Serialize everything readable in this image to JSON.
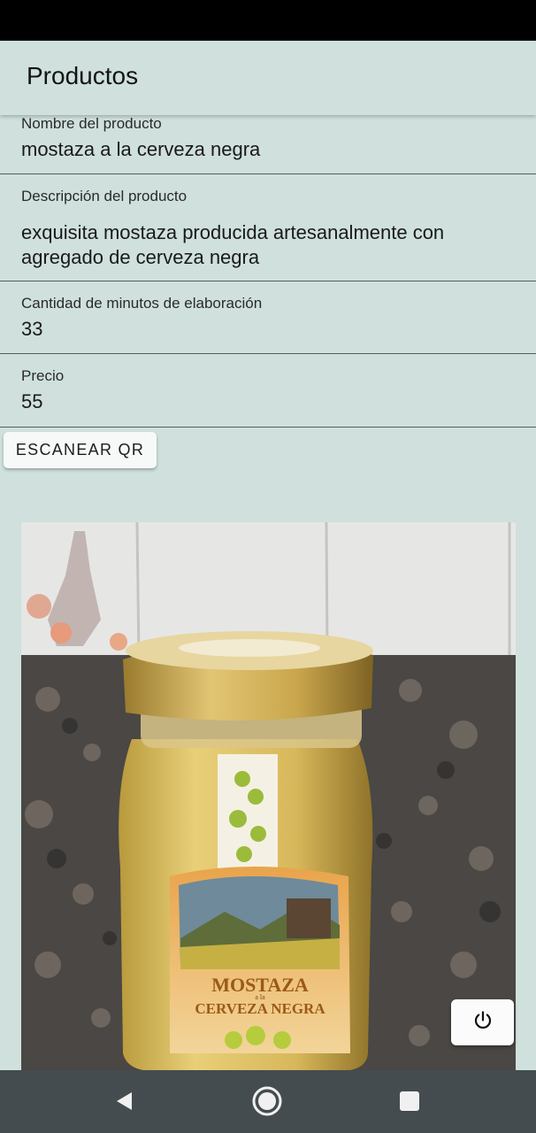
{
  "app_bar": {
    "title": "Productos"
  },
  "form": {
    "name": {
      "label": "Nombre del producto",
      "value": "mostaza a la cerveza negra"
    },
    "description": {
      "label": "Descripción del producto",
      "value": "exquisita mostaza producida artesanalmente con agregado de cerveza negra"
    },
    "minutes": {
      "label": "Cantidad de minutos de elaboración",
      "value": "33"
    },
    "price": {
      "label": "Precio",
      "value": "55"
    }
  },
  "actions": {
    "scan_qr_label": "ESCANEAR QR"
  },
  "photo": {
    "jar_label_line1": "MOSTAZA",
    "jar_label_small": "a la",
    "jar_label_line2": "CERVEZA NEGRA"
  },
  "icons": {
    "power": "power-icon",
    "back": "back-triangle-icon",
    "home": "home-circle-icon",
    "recents": "recents-square-icon"
  },
  "colors": {
    "background": "#cfe0dd",
    "nav_bar": "#444c4f",
    "status_bar": "#000000"
  }
}
